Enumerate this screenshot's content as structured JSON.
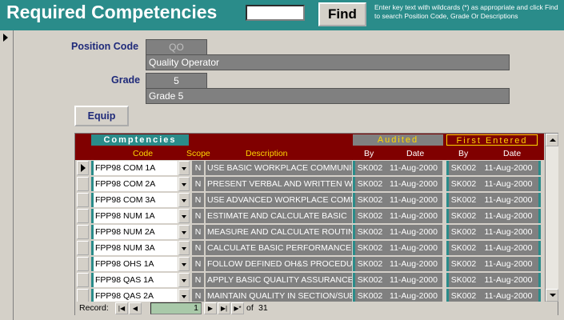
{
  "header": {
    "title": "Required Competencies",
    "search_value": "",
    "find_label": "Find",
    "hint": "Enter key text with wildcards (*) as appropriate and click Find to search  Position Code, Grade Or Descriptions"
  },
  "form": {
    "position_code_label": "Position Code",
    "position_code": "QO",
    "position_name": "Quality Operator",
    "grade_label": "Grade",
    "grade": "5",
    "grade_name": "Grade 5",
    "equip_label": "Equip"
  },
  "grid": {
    "title": "Comptencies",
    "group_audited": "Audited",
    "group_first": "First  Entered",
    "col_code": "Code",
    "col_scope": "Scope",
    "col_description": "Description",
    "col_aud_by": "By",
    "col_aud_date": "Date",
    "col_first_by": "By",
    "col_first_date": "Date",
    "rows": [
      {
        "code": "FPP98 COM 1A",
        "scope": "N",
        "description": "USE BASIC WORKPLACE COMMUNICATION",
        "aud_by": "SK002",
        "aud_date": "11-Aug-2000",
        "first_by": "SK002",
        "first_date": "11-Aug-2000"
      },
      {
        "code": "FPP98 COM 2A",
        "scope": "N",
        "description": "PRESENT VERBAL AND WRITTEN WORK",
        "aud_by": "SK002",
        "aud_date": "11-Aug-2000",
        "first_by": "SK002",
        "first_date": "11-Aug-2000"
      },
      {
        "code": "FPP98 COM 3A",
        "scope": "N",
        "description": "USE ADVANCED WORKPLACE COMMUNICATION",
        "aud_by": "SK002",
        "aud_date": "11-Aug-2000",
        "first_by": "SK002",
        "first_date": "11-Aug-2000"
      },
      {
        "code": "FPP98 NUM 1A",
        "scope": "N",
        "description": "ESTIMATE AND CALCULATE BASIC",
        "aud_by": "SK002",
        "aud_date": "11-Aug-2000",
        "first_by": "SK002",
        "first_date": "11-Aug-2000"
      },
      {
        "code": "FPP98 NUM 2A",
        "scope": "N",
        "description": "MEASURE AND CALCULATE ROUTINE",
        "aud_by": "SK002",
        "aud_date": "11-Aug-2000",
        "first_by": "SK002",
        "first_date": "11-Aug-2000"
      },
      {
        "code": "FPP98 NUM 3A",
        "scope": "N",
        "description": "CALCULATE BASIC PERFORMANCE",
        "aud_by": "SK002",
        "aud_date": "11-Aug-2000",
        "first_by": "SK002",
        "first_date": "11-Aug-2000"
      },
      {
        "code": "FPP98 OHS 1A",
        "scope": "N",
        "description": "FOLLOW DEFINED OH&S PROCEDURES",
        "aud_by": "SK002",
        "aud_date": "11-Aug-2000",
        "first_by": "SK002",
        "first_date": "11-Aug-2000"
      },
      {
        "code": "FPP98 QAS 1A",
        "scope": "N",
        "description": "APPLY BASIC QUALITY ASSURANCE",
        "aud_by": "SK002",
        "aud_date": "11-Aug-2000",
        "first_by": "SK002",
        "first_date": "11-Aug-2000"
      },
      {
        "code": "FPP98 QAS 2A",
        "scope": "N",
        "description": "MAINTAIN QUALITY IN SECTION/SUB",
        "aud_by": "SK002",
        "aud_date": "11-Aug-2000",
        "first_by": "SK002",
        "first_date": "11-Aug-2000"
      }
    ]
  },
  "nav": {
    "record_label": "Record:",
    "current": "1",
    "of_label": "of",
    "total": "31"
  },
  "colors": {
    "header_bg": "#2a8c8a",
    "grid_header_bg": "#800000",
    "accent_gold": "#ffd700",
    "label_blue": "#1f2a7a"
  },
  "icons": [
    "record-selector-icon",
    "dropdown-arrow-icon",
    "nav-first-icon",
    "nav-prev-icon",
    "nav-next-icon",
    "nav-last-icon",
    "nav-new-icon",
    "scroll-up-icon",
    "scroll-down-icon"
  ]
}
